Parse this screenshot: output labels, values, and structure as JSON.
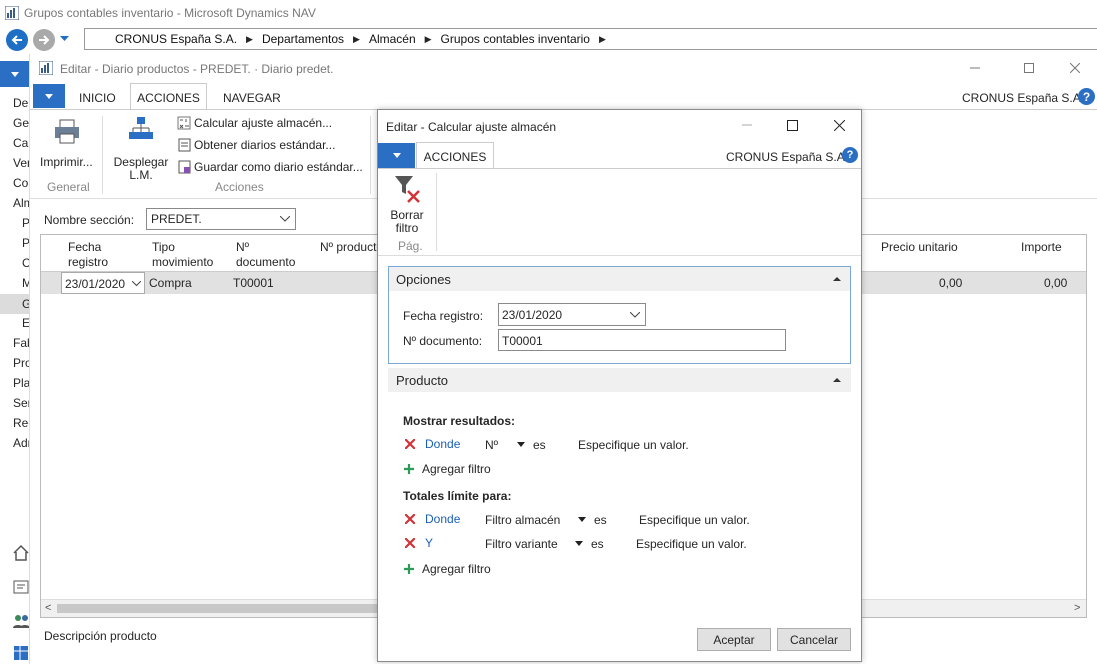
{
  "app": {
    "title": "Grupos contables inventario - Microsoft Dynamics NAV",
    "breadcrumb": [
      "CRONUS España S.A.",
      "Departamentos",
      "Almacén",
      "Grupos contables inventario"
    ],
    "nav_items": [
      "Departamentos",
      "Gestión financiera",
      "Cartera",
      "Ventas y marketing",
      "Compras",
      "Almacén",
      "Planificación",
      "Productos",
      "Control de calidad",
      "Movimientos",
      "Grupos contables inventario",
      "Existencias",
      "Fabricación",
      "Proyectos",
      "Planificación de recursos",
      "Servicio",
      "Recursos humanos",
      "Administración"
    ]
  },
  "journal": {
    "title": "Editar - Diario productos - PREDET. · Diario predet.",
    "tabs": [
      "INICIO",
      "ACCIONES",
      "NAVEGAR"
    ],
    "company": "CRONUS España S.A.",
    "print_label": "Imprimir...",
    "group_general": "General",
    "explode_label": "Desplegar L.M.",
    "actions": [
      "Calcular ajuste almacén...",
      "Obtener diarios estándar...",
      "Guardar como diario estándar..."
    ],
    "group_actions": "Acciones",
    "section_label": "Nombre sección:",
    "section_value": "PREDET.",
    "columns": [
      "Fecha registro",
      "Tipo movimiento",
      "Nº documento",
      "Nº producto",
      "Precio unitario",
      "Importe"
    ],
    "row": {
      "date": "23/01/2020",
      "type": "Compra",
      "doc": "T00001",
      "price": "0,00",
      "amount": "0,00"
    },
    "footer_label": "Descripción producto"
  },
  "dialog": {
    "title": "Editar - Calcular ajuste almacén",
    "tab": "ACCIONES",
    "company": "CRONUS España S.A.",
    "clear_filter": "Borrar filtro",
    "group_page": "Pág.",
    "options": {
      "title": "Opciones",
      "date_label": "Fecha registro:",
      "date_value": "23/01/2020",
      "doc_label": "Nº documento:",
      "doc_value": "T00001"
    },
    "product": {
      "title": "Producto",
      "show_results": "Mostrar resultados:",
      "filter1": {
        "conj": "Donde",
        "field": "Nº",
        "op": "es",
        "value": "Especifique un valor."
      },
      "add_filter": "Agregar filtro",
      "totals": "Totales límite para:",
      "filter2": {
        "conj": "Donde",
        "field": "Filtro almacén",
        "op": "es",
        "value": "Especifique un valor."
      },
      "filter3": {
        "conj": "Y",
        "field": "Filtro variante",
        "op": "es",
        "value": "Especifique un valor."
      }
    },
    "accept": "Aceptar",
    "cancel": "Cancelar"
  },
  "colors": {
    "accent": "#2b6fc4",
    "remove": "#d13438",
    "add": "#2e9a57"
  }
}
